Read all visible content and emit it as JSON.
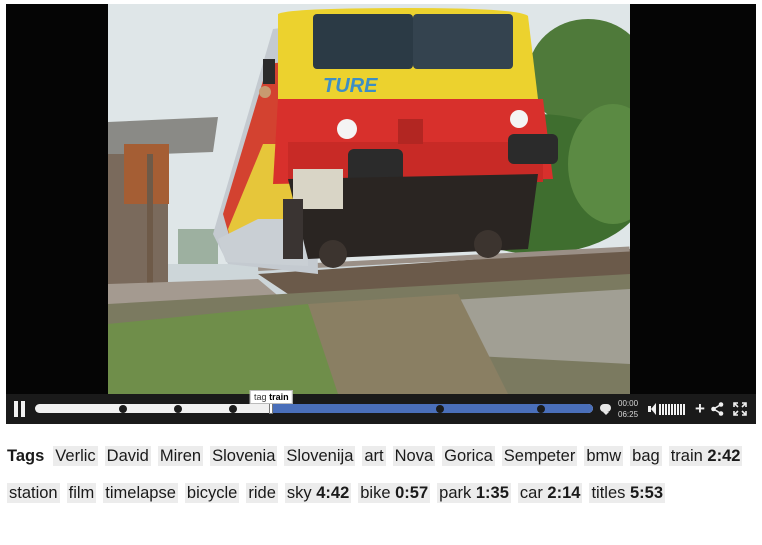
{
  "player": {
    "tooltip": {
      "prefix": "tag",
      "name": "train"
    },
    "time": {
      "current": "00:00",
      "duration": "06:25"
    },
    "progress_fraction": 0.4235,
    "tag_markers_fraction": [
      0.158,
      0.257,
      0.355,
      0.725,
      0.907
    ],
    "colors": {
      "progress": "#4a6fba",
      "track": "#f0f0f0",
      "bar": "#1a1a1a"
    }
  },
  "tags": {
    "label": "Tags",
    "items": [
      {
        "name": "Verlic",
        "time": ""
      },
      {
        "name": "David",
        "time": ""
      },
      {
        "name": "Miren",
        "time": ""
      },
      {
        "name": "Slovenia",
        "time": ""
      },
      {
        "name": "Slovenija",
        "time": ""
      },
      {
        "name": "art",
        "time": ""
      },
      {
        "name": "Nova",
        "time": ""
      },
      {
        "name": "Gorica",
        "time": ""
      },
      {
        "name": "Sempeter",
        "time": ""
      },
      {
        "name": "bmw",
        "time": ""
      },
      {
        "name": "bag",
        "time": ""
      },
      {
        "name": "train",
        "time": "2:42"
      },
      {
        "name": "station",
        "time": ""
      },
      {
        "name": "film",
        "time": ""
      },
      {
        "name": "timelapse",
        "time": ""
      },
      {
        "name": "bicycle",
        "time": ""
      },
      {
        "name": "ride",
        "time": ""
      },
      {
        "name": "sky",
        "time": "4:42"
      },
      {
        "name": "bike",
        "time": "0:57"
      },
      {
        "name": "park",
        "time": "1:35"
      },
      {
        "name": "car",
        "time": "2:14"
      },
      {
        "name": "titles",
        "time": "5:53"
      }
    ]
  }
}
